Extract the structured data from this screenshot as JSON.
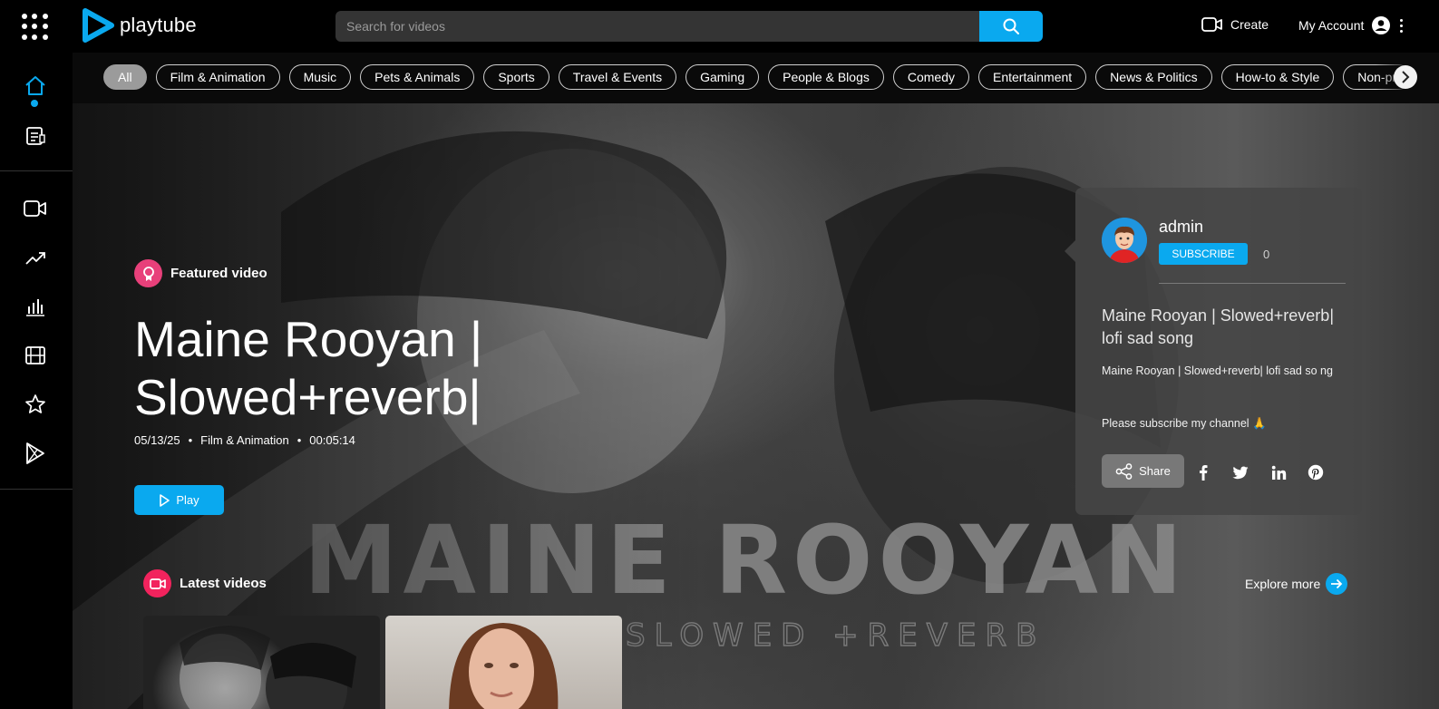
{
  "header": {
    "logo_text": "playtube",
    "search_placeholder": "Search for videos",
    "create_label": "Create",
    "account_label": "My Account"
  },
  "categories": [
    "All",
    "Film & Animation",
    "Music",
    "Pets & Animals",
    "Sports",
    "Travel & Events",
    "Gaming",
    "People & Blogs",
    "Comedy",
    "Entertainment",
    "News & Politics",
    "How-to & Style",
    "Non-pr"
  ],
  "featured": {
    "badge": "Featured video",
    "title": "Maine Rooyan | Slowed+reverb|",
    "date": "05/13/25",
    "category": "Film & Animation",
    "duration": "00:05:14",
    "play_label": "Play",
    "art_text": "MAINE ROOYAN",
    "art_subtext": "SLOWED +REVERB"
  },
  "channel_card": {
    "name": "admin",
    "subscribe_label": "SUBSCRIBE",
    "subscriber_count": "0",
    "title": "Maine Rooyan | Slowed+reverb| lofi sad song",
    "description": "Maine Rooyan | Slowed+reverb| lofi sad so ng",
    "note": "Please subscribe my channel 🙏",
    "share_label": "Share"
  },
  "latest": {
    "heading": "Latest videos",
    "explore_label": "Explore more"
  },
  "colors": {
    "accent": "#0aa9ef",
    "featured_badge": "#e8407a",
    "latest_badge": "#f2235d"
  }
}
